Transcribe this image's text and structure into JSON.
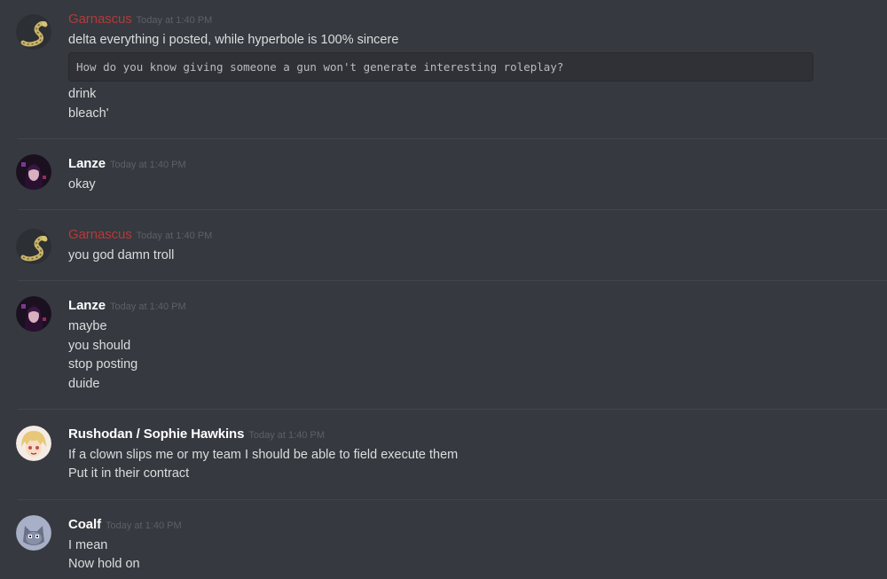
{
  "colors": {
    "background": "#36393f",
    "divider": "#42454a",
    "red_username": "#b33a3a",
    "text": "#dcddde",
    "timestamp": "#5d6066"
  },
  "messages": [
    {
      "author": "Garnascus",
      "timestamp": "Today at 1:40 PM",
      "avatar_icon": "snake-avatar-icon",
      "lines": [
        "delta everything i posted, while hyperbole is 100% sincere"
      ],
      "code": "How do you know giving someone a gun won't generate interesting roleplay?",
      "after_code": [
        "drink",
        "bleach'"
      ]
    },
    {
      "author": "Lanze",
      "timestamp": "Today at 1:40 PM",
      "avatar_icon": "dark-anime-avatar-icon",
      "lines": [
        "okay"
      ]
    },
    {
      "author": "Garnascus",
      "timestamp": "Today at 1:40 PM",
      "avatar_icon": "snake-avatar-icon",
      "lines": [
        "you god damn troll"
      ]
    },
    {
      "author": "Lanze",
      "timestamp": "Today at 1:40 PM",
      "avatar_icon": "dark-anime-avatar-icon",
      "lines": [
        "maybe",
        "you should",
        "stop posting",
        "duide"
      ]
    },
    {
      "author": "Rushodan / Sophie Hawkins",
      "timestamp": "Today at 1:40 PM",
      "avatar_icon": "blonde-anime-avatar-icon",
      "lines": [
        "If a clown slips me or my team I should be able to field execute them",
        "Put it in their contract"
      ]
    },
    {
      "author": "Coalf",
      "timestamp": "Today at 1:40 PM",
      "avatar_icon": "grey-creature-avatar-icon",
      "lines": [
        "I mean",
        "Now hold on"
      ]
    }
  ]
}
